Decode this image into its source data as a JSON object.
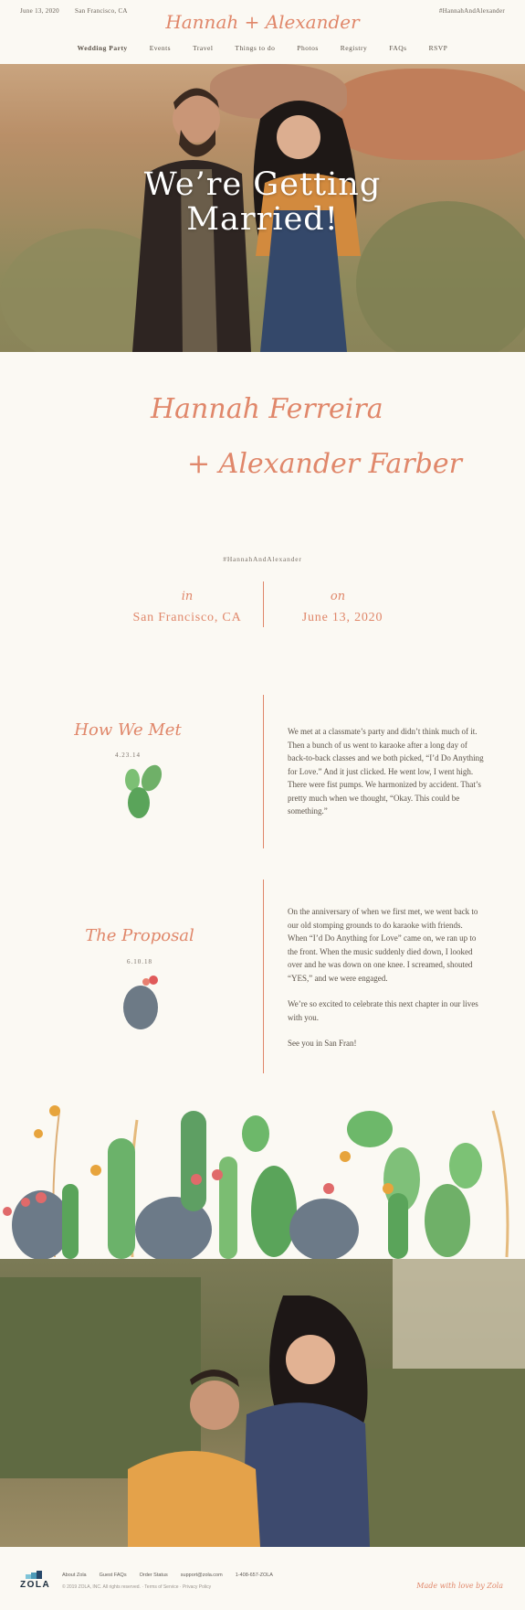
{
  "header": {
    "date": "June 13, 2020",
    "location": "San Francisco, CA",
    "logo": "Hannah + Alexander",
    "hashtag": "#HannahAndAlexander",
    "nav": [
      "Wedding Party",
      "Events",
      "Travel",
      "Things to do",
      "Photos",
      "Registry",
      "FAQs",
      "RSVP"
    ]
  },
  "hero": {
    "title_line1": "We’re Getting",
    "title_line2": "Married!"
  },
  "couple": {
    "name1": "Hannah Ferreira",
    "name2": "+ Alexander Farber",
    "hashtag": "#HannahAndAlexander"
  },
  "details": {
    "in_label": "in",
    "in_value": "San Francisco, CA",
    "on_label": "on",
    "on_value": "June 13, 2020"
  },
  "stories": [
    {
      "title": "How We Met",
      "date": "4.23.14",
      "paragraphs": [
        "We met at a classmate’s party and didn’t think much of it. Then a bunch of us went to karaoke after a long day of back-to-back classes and we both picked, “I’d Do Anything for Love.” And it just clicked. He went low, I went high. There were fist pumps. We harmonized by accident. That’s pretty much when we thought, “Okay. This could be something.”"
      ]
    },
    {
      "title": "The Proposal",
      "date": "6.10.18",
      "paragraphs": [
        "On the anniversary of when we first met, we went back to our old stomping grounds to do karaoke with friends. When “I’d Do Anything for Love” came on, we ran up to the front. When the music suddenly died down, I looked over and he was down on one knee. I screamed, shouted “YES,” and we were engaged.",
        "We’re so excited to celebrate this next chapter in our lives with you.",
        "See you in San Fran!"
      ]
    }
  ],
  "footer": {
    "brand": "ZOLA",
    "links": [
      "About Zola",
      "Guest FAQs",
      "Order Status",
      "support@zola.com",
      "1-408-657-ZOLA"
    ],
    "copyright": "© 2019 ZOLA, INC. All rights reserved. · Terms of Service · Privacy Policy",
    "made_with": "Made with love by Zola"
  },
  "colors": {
    "accent": "#e0876a",
    "background": "#fbf9f3",
    "text": "#5a5147"
  },
  "icons": [
    "cactus-icon",
    "round-cactus-icon"
  ]
}
